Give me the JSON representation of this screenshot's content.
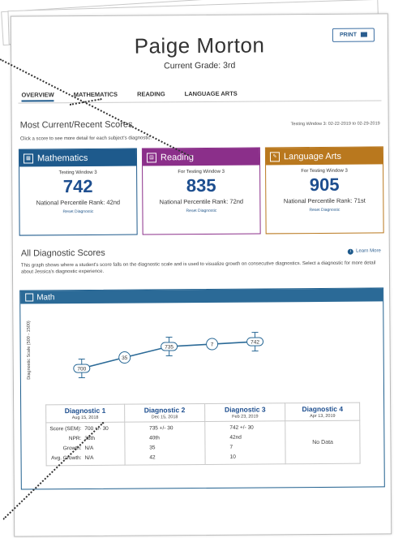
{
  "print_label": "PRINT",
  "student_name": "Paige Morton",
  "grade": "Current Grade: 3rd",
  "tabs": [
    "OVERVIEW",
    "MATHEMATICS",
    "READING",
    "LANGUAGE ARTS"
  ],
  "recent": {
    "title": "Most Current/Recent Scores",
    "testing_window": "Testing Window 3: 02-22-2019 to 02-29-2019",
    "instruction": "Click a score to see more detail for each subject's diagnostic.",
    "cards": [
      {
        "subject": "Mathematics",
        "window": "Testing Window 3",
        "score": "742",
        "npr": "National Percentile Rank: 42nd",
        "reset": "Reset Diagnostic",
        "color": "#1e5a8c"
      },
      {
        "subject": "Reading",
        "window": "For Testing Window 3",
        "score": "835",
        "npr": "National Percentile Rank: 72nd",
        "reset": "Reset Diagnostic",
        "color": "#8b2f8a"
      },
      {
        "subject": "Language Arts",
        "window": "For Testing Window 3",
        "score": "905",
        "npr": "National Percentile Rank: 71st",
        "reset": "Reset Diagnostic",
        "color": "#b9781e"
      }
    ]
  },
  "all_scores": {
    "title": "All Diagnostic Scores",
    "learn_more": "Learn More",
    "description": "This graph shows where a student's score falls on the diagnostic scale and is used to visualize growth on consecutive diagnostics. Select a diagnostic for more detail about Jessica's diagnostic experience.",
    "math_label": "Math",
    "y_axis_label": "Diagnostic Scale (500 - 1500)"
  },
  "chart_data": {
    "type": "line",
    "x": [
      "Diagnostic 1",
      "Diagnostic 2",
      "Diagnostic 3"
    ],
    "series": [
      {
        "values": [
          700,
          735,
          742
        ],
        "labels": [
          "700",
          "735",
          "742"
        ],
        "error": [
          30,
          30,
          30
        ]
      },
      {
        "values": [
          35,
          7
        ],
        "labels": [
          "35",
          "7"
        ]
      }
    ]
  },
  "diagnostics": [
    {
      "name": "Diagnostic 1",
      "date": "Aug 15, 2018"
    },
    {
      "name": "Diagnostic 2",
      "date": "Dec 15, 2018"
    },
    {
      "name": "Diagnostic 3",
      "date": "Feb 23, 2019"
    },
    {
      "name": "Diagnostic 4",
      "date": "Apr 13, 2019"
    }
  ],
  "rows": {
    "labels": [
      "Score (SEM):",
      "NPR:",
      "Growth:",
      "Avg. Growth:"
    ],
    "d1": [
      "700 +/- 30",
      "38th",
      "N/A",
      "N/A"
    ],
    "d2": [
      "735 +/- 30",
      "40th",
      "35",
      "42"
    ],
    "d3": [
      "742 +/- 30",
      "42nd",
      "7",
      "10"
    ],
    "no_data": "No Data"
  },
  "colors": {
    "primary": "#1e5a8c",
    "reading": "#8b2f8a",
    "language": "#b9781e"
  }
}
